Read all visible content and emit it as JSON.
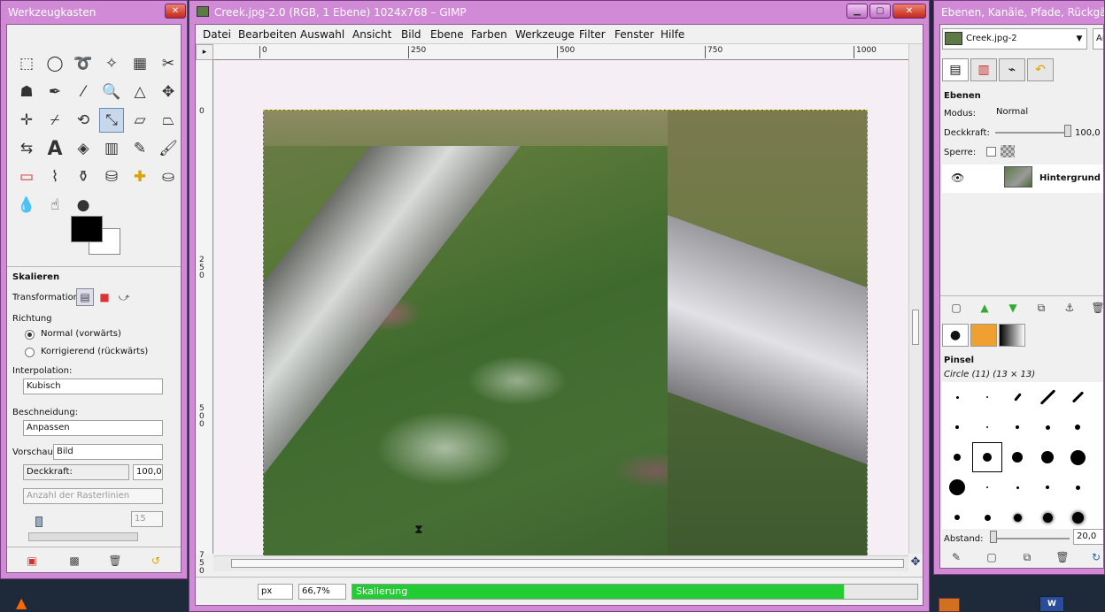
{
  "toolbox": {
    "title": "Werkzeugkasten",
    "options_title": "Skalieren",
    "transformation_label": "Transformation:",
    "richtung_label": "Richtung",
    "dir_normal": "Normal (vorwärts)",
    "dir_korr": "Korrigierend (rückwärts)",
    "interp_label": "Interpolation:",
    "interp_value": "Kubisch",
    "beschneidung_label": "Beschneidung:",
    "beschneidung_value": "Anpassen",
    "vorschau_label": "Vorschau:",
    "vorschau_value": "Bild",
    "deckkraft_label": "Deckkraft:",
    "deckkraft_value": "100,0",
    "raster_placeholder": "Anzahl der Rasterlinien",
    "raster_value": "15"
  },
  "main": {
    "title": "Creek.jpg-2.0 (RGB, 1 Ebene) 1024x768 – GIMP",
    "menus": [
      "Datei",
      "Bearbeiten",
      "Auswahl",
      "Ansicht",
      "Bild",
      "Ebene",
      "Farben",
      "Werkzeuge",
      "Filter",
      "Fenster",
      "Hilfe"
    ],
    "ruler_h": [
      "0",
      "250",
      "500",
      "750",
      "1000"
    ],
    "ruler_v": [
      "0",
      "250",
      "500",
      "750"
    ],
    "unit": "px",
    "zoom": "66,7%",
    "status_text": "Skalierung",
    "progress": 0.87
  },
  "dock": {
    "title": "Ebenen, Kanäle, Pfade, Rückgäng...",
    "image_select": "Creek.jpg-2",
    "auto_label": "Au",
    "layers_title": "Ebenen",
    "modus_label": "Modus:",
    "modus_value": "Normal",
    "deckkraft_label": "Deckkraft:",
    "deckkraft_value": "100,0",
    "sperre_label": "Sperre:",
    "layer_name": "Hintergrund",
    "pinsel_title": "Pinsel",
    "brush_name": "Circle (11) (13 × 13)",
    "abstand_label": "Abstand:",
    "abstand_value": "20,0"
  }
}
